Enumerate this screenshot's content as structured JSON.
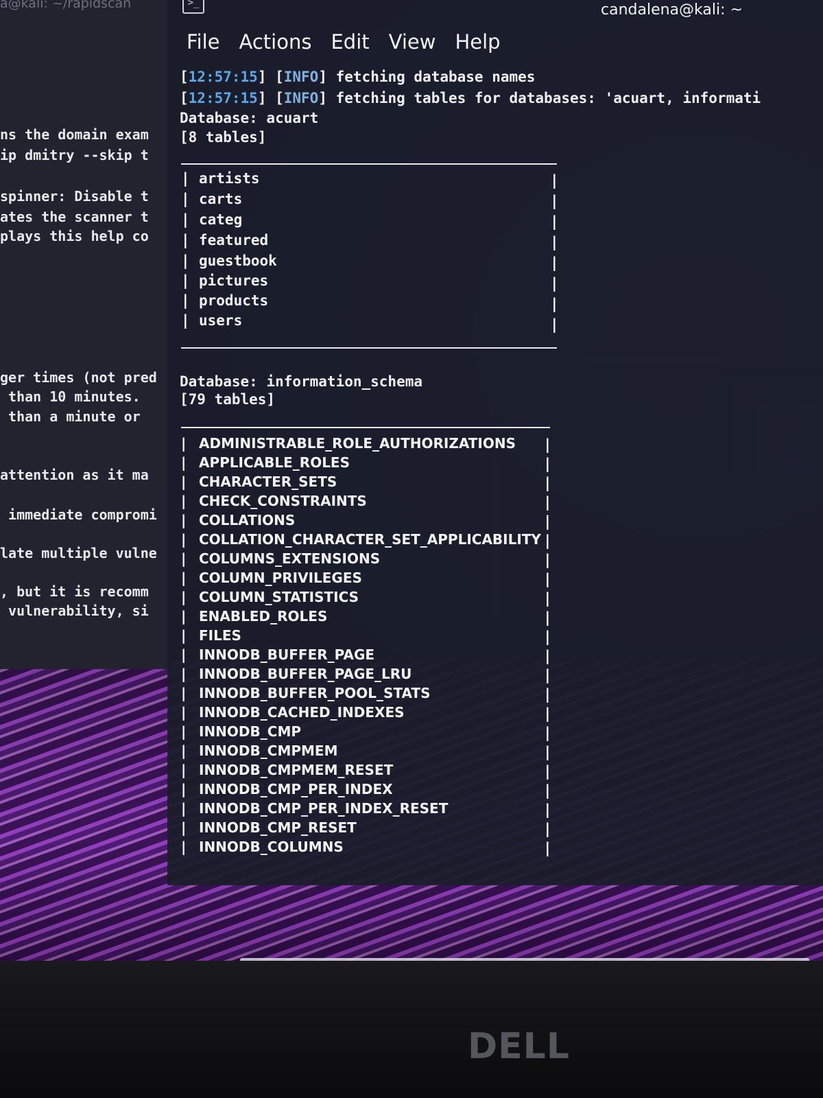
{
  "background_terminal": {
    "title": "a@kali: ~/rapidscan",
    "lines": [
      "ns the domain exam",
      "ip dmitry --skip t",
      "spinner: Disable t",
      "ates the scanner t",
      "plays this help co",
      "ger times (not pred",
      " than 10 minutes.",
      " than a minute or",
      "attention as it ma",
      " immediate compromi",
      "late multiple vulne",
      ", but it is recomm",
      " vulnerability, si"
    ]
  },
  "terminal": {
    "title": "candalena@kali: ~",
    "menu": [
      "File",
      "Actions",
      "Edit",
      "View",
      "Help"
    ],
    "log": [
      {
        "time": "12:57:15",
        "level": "INFO",
        "message": " fetching database names"
      },
      {
        "time": "12:57:15",
        "level": "INFO",
        "message": " fetching tables for databases: 'acuart, informati"
      }
    ],
    "databases": [
      {
        "header": "Database: acuart",
        "count": "[8 tables]",
        "tables": [
          "artists",
          "carts",
          "categ",
          "featured",
          "guestbook",
          "pictures",
          "products",
          "users"
        ]
      },
      {
        "header": "Database: information_schema",
        "count": "[79 tables]",
        "tables": [
          "ADMINISTRABLE_ROLE_AUTHORIZATIONS",
          "APPLICABLE_ROLES",
          "CHARACTER_SETS",
          "CHECK_CONSTRAINTS",
          "COLLATIONS",
          "COLLATION_CHARACTER_SET_APPLICABILITY",
          "COLUMNS_EXTENSIONS",
          "COLUMN_PRIVILEGES",
          "COLUMN_STATISTICS",
          "ENABLED_ROLES",
          "FILES",
          "INNODB_BUFFER_PAGE",
          "INNODB_BUFFER_PAGE_LRU",
          "INNODB_BUFFER_POOL_STATS",
          "INNODB_CACHED_INDEXES",
          "INNODB_CMP",
          "INNODB_CMPMEM",
          "INNODB_CMPMEM_RESET",
          "INNODB_CMP_PER_INDEX",
          "INNODB_CMP_PER_INDEX_RESET",
          "INNODB_CMP_RESET",
          "INNODB_COLUMNS"
        ]
      }
    ]
  },
  "laptop": {
    "brand": "DELL"
  }
}
